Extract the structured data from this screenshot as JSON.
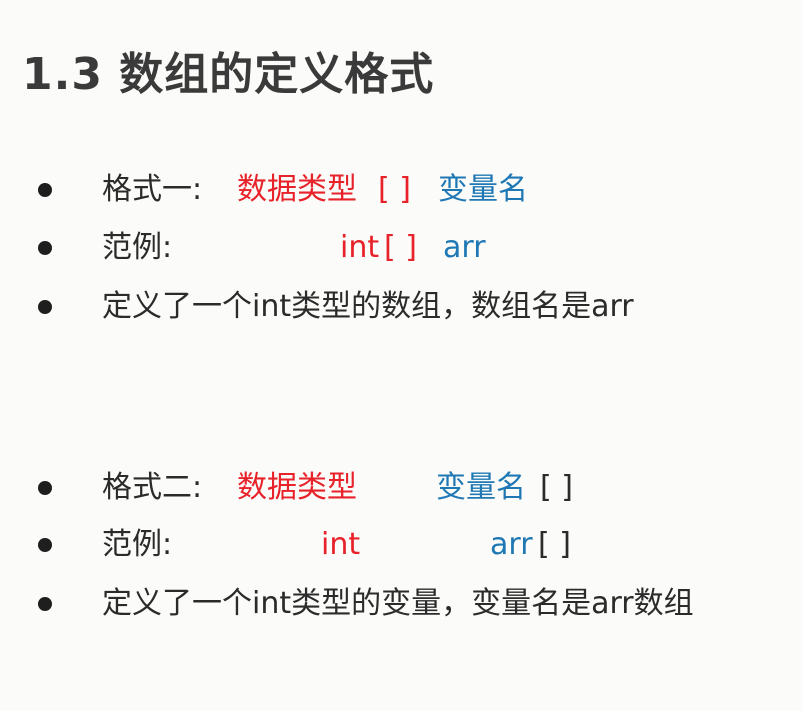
{
  "title": "1.3 数组的定义格式",
  "format1": {
    "line1": {
      "label": "格式一:",
      "type": "数据类型",
      "brackets": "[ ]",
      "var": "变量名"
    },
    "line2": {
      "label": "范例:",
      "type": "int",
      "brackets": "[ ]",
      "var": "arr"
    },
    "line3": {
      "text": "定义了一个int类型的数组，数组名是arr"
    }
  },
  "format2": {
    "line1": {
      "label": "格式二:",
      "type": "数据类型",
      "var": "变量名",
      "brackets": "[ ]"
    },
    "line2": {
      "label": "范例:",
      "type": "int",
      "var": "arr",
      "brackets": "[ ]"
    },
    "line3": {
      "text": "定义了一个int类型的变量，变量名是arr数组"
    }
  },
  "colors": {
    "type": "#e8222a",
    "variable": "#1f78b4",
    "text": "#2b2b2b",
    "title": "#3a3a3a"
  }
}
